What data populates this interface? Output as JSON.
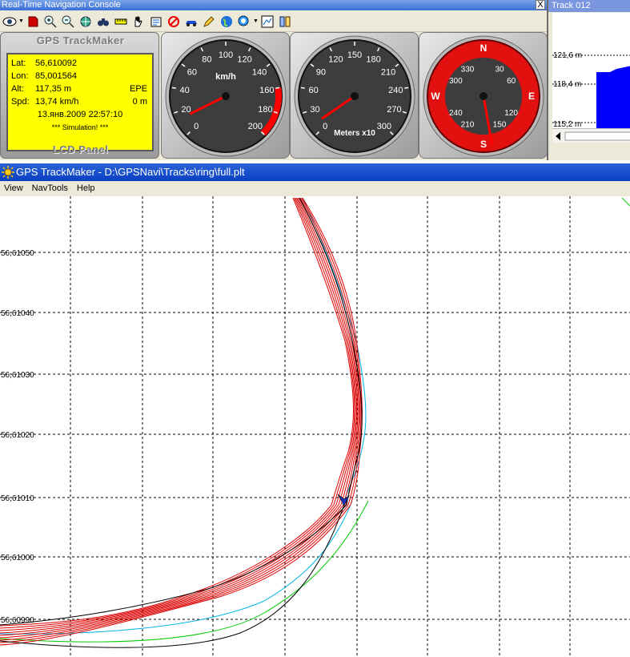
{
  "console": {
    "title": "Real-Time Navigation Console",
    "close_label": "X",
    "lcd": {
      "brand": "GPS TrackMaker",
      "panel_label": "LCD Panel",
      "lat_label": "Lat:",
      "lat": "56,610092",
      "lon_label": "Lon:",
      "lon": "85,001564",
      "alt_label": "Alt:",
      "alt": "117,35 m",
      "epe_label": "EPE",
      "epe": "0 m",
      "spd_label": "Spd:",
      "spd": "13,74 km/h",
      "datetime": "13.янв.2009 22:57:10",
      "status": "*** Simulation! ***"
    },
    "speed_gauge": {
      "unit": "km/h",
      "ticks": [
        "0",
        "20",
        "40",
        "60",
        "80",
        "100",
        "120",
        "140",
        "160",
        "180",
        "200"
      ],
      "value": 13.74
    },
    "altitude_gauge": {
      "unit": "Meters x10",
      "ticks": [
        "0",
        "30",
        "60",
        "90",
        "120",
        "150",
        "180",
        "210",
        "240",
        "270",
        "300"
      ],
      "value": 11.7
    },
    "compass": {
      "labels": [
        "N",
        "30",
        "60",
        "E",
        "120",
        "150",
        "S",
        "210",
        "240",
        "W",
        "300",
        "330"
      ],
      "heading": 170
    }
  },
  "track_panel": {
    "title": "Track 012",
    "alt_labels": [
      "121,6 m",
      "118,4 m",
      "115,2 m"
    ]
  },
  "main": {
    "title": "GPS TrackMaker - D:\\GPSNavi\\Tracks\\ring\\full.plt",
    "menu": [
      "View",
      "NavTools",
      "Help"
    ],
    "lat_labels": [
      "56,61050",
      "56,61040",
      "56,61030",
      "56,61020",
      "56,61010",
      "56,61000",
      "56,60990"
    ]
  },
  "colors": {
    "track_primary": "#dd0000",
    "track_black": "#000000",
    "track_cyan": "#00b4e6",
    "track_green": "#00cc00",
    "cursor": "#1030c0"
  }
}
